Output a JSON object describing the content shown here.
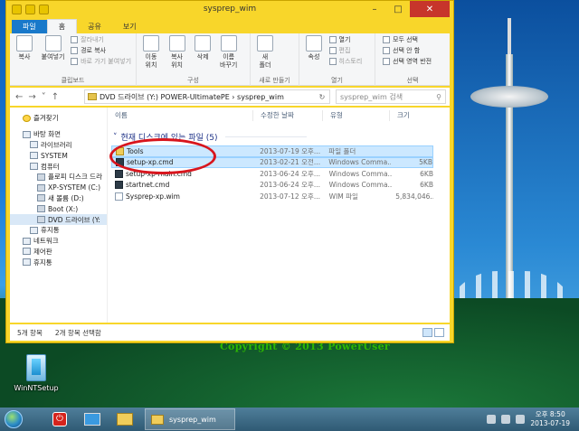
{
  "window": {
    "title": "sysprep_wim",
    "tabs": [
      "파일",
      "홈",
      "공유",
      "보기"
    ]
  },
  "ribbon": {
    "clipboard": {
      "label": "클립보드",
      "copy": "복사",
      "paste": "붙여넣기",
      "cut": "잘라내기",
      "copy_path": "경로 복사",
      "paste_shortcut": "바로 가기 붙여넣기"
    },
    "organize": {
      "label": "구성",
      "move_to": "이동\n위치",
      "copy_to": "복사\n위치",
      "delete": "삭제",
      "rename": "이름\n바꾸기"
    },
    "new": {
      "label": "새로 만들기",
      "new_folder": "새\n폴더"
    },
    "open": {
      "label": "열기",
      "properties": "속성",
      "open": "열기",
      "edit": "편집",
      "history": "히스토리"
    },
    "select": {
      "label": "선택",
      "select_all": "모두 선택",
      "select_none": "선택 안 함",
      "invert": "선택 영역 반전"
    }
  },
  "address": {
    "path": "DVD 드라이브 (Y:) POWER-UltimatePE  ›  sysprep_wim",
    "search_placeholder": "sysprep_wim 검색"
  },
  "navpane": {
    "items": [
      {
        "label": "즐겨찾기"
      },
      {
        "label": "바탕 화면"
      },
      {
        "label": "라이브러리"
      },
      {
        "label": "SYSTEM"
      },
      {
        "label": "컴퓨터"
      },
      {
        "label": "플로피 디스크 드라"
      },
      {
        "label": "XP-SYSTEM (C:)"
      },
      {
        "label": "새 볼륨 (D:)"
      },
      {
        "label": "Boot (X:)"
      },
      {
        "label": "DVD 드라이브 (Y:"
      },
      {
        "label": "휴지통"
      },
      {
        "label": "네트워크"
      },
      {
        "label": "제어판"
      },
      {
        "label": "휴지통"
      }
    ]
  },
  "columns": {
    "name": "이름",
    "date": "수정한 날짜",
    "type": "유형",
    "size": "크기"
  },
  "group_header": "현재 디스크에 있는 파일 (5)",
  "files": [
    {
      "name": "Tools",
      "date": "2013-07-19 오후...",
      "type": "파일 폴더",
      "size": ""
    },
    {
      "name": "setup-xp.cmd",
      "date": "2013-02-21 오전...",
      "type": "Windows Comma...",
      "size": "5KB"
    },
    {
      "name": "setup-xp-main.cmd",
      "date": "2013-06-24 오후...",
      "type": "Windows Comma...",
      "size": "6KB"
    },
    {
      "name": "startnet.cmd",
      "date": "2013-06-24 오후...",
      "type": "Windows Comma...",
      "size": "6KB"
    },
    {
      "name": "Sysprep-xp.wim",
      "date": "2013-07-12 오후...",
      "type": "WIM 파일",
      "size": "5,834,046..."
    }
  ],
  "status": {
    "items": "5개 항목",
    "selected": "2개 항목 선택함"
  },
  "desktop": {
    "icon_label": "WinNTSetup",
    "copyright": "Copyright © 2013 PowerUser"
  },
  "taskbar": {
    "task_label": "sysprep_wim",
    "time": "오후 8:50",
    "date": "2013-07-19"
  }
}
